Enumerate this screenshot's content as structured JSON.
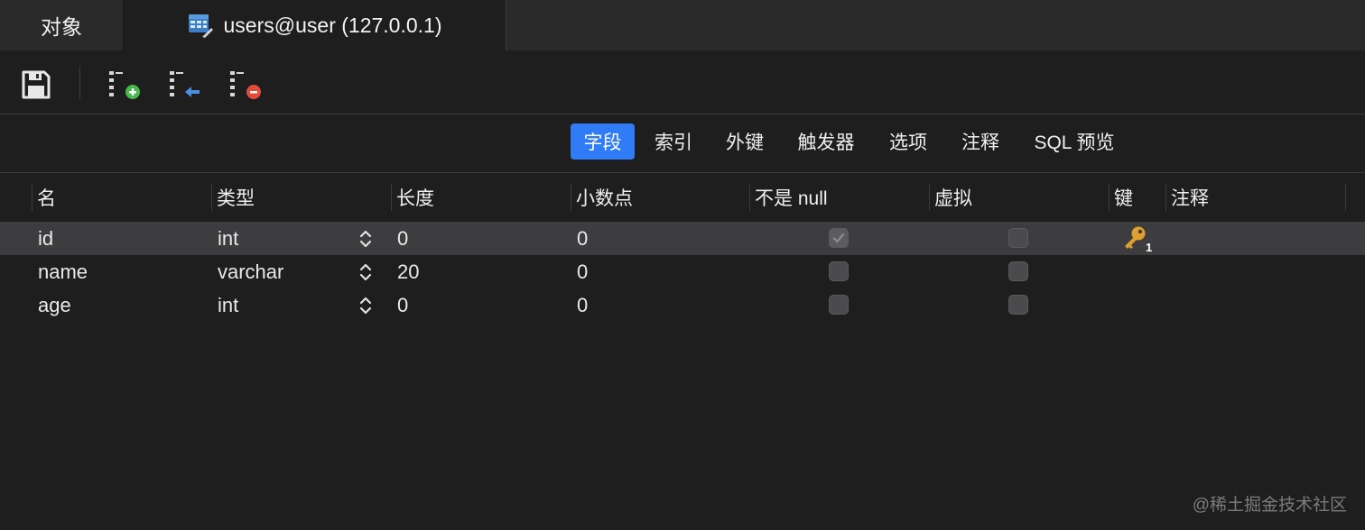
{
  "tabs": {
    "objects": "对象",
    "table": "users@user (127.0.0.1)"
  },
  "toolbar": {
    "save": "save-icon",
    "add_field": "add-field-icon",
    "insert_field": "insert-field-icon",
    "delete_field": "delete-field-icon"
  },
  "subtabs": [
    "字段",
    "索引",
    "外键",
    "触发器",
    "选项",
    "注释",
    "SQL 预览"
  ],
  "columns": [
    "名",
    "类型",
    "长度",
    "小数点",
    "不是 null",
    "虚拟",
    "键",
    "注释"
  ],
  "rows": [
    {
      "name": "id",
      "type": "int",
      "length": "0",
      "decimals": "0",
      "not_null": true,
      "virtual": false,
      "key": "1",
      "comment": ""
    },
    {
      "name": "name",
      "type": "varchar",
      "length": "20",
      "decimals": "0",
      "not_null": false,
      "virtual": false,
      "key": "",
      "comment": ""
    },
    {
      "name": "age",
      "type": "int",
      "length": "0",
      "decimals": "0",
      "not_null": false,
      "virtual": false,
      "key": "",
      "comment": ""
    }
  ],
  "watermark": "@稀土掘金技术社区",
  "colors": {
    "accent": "#2f7cf6",
    "key": "#e0a030",
    "add": "#49b84a",
    "delete": "#e24b3b"
  }
}
